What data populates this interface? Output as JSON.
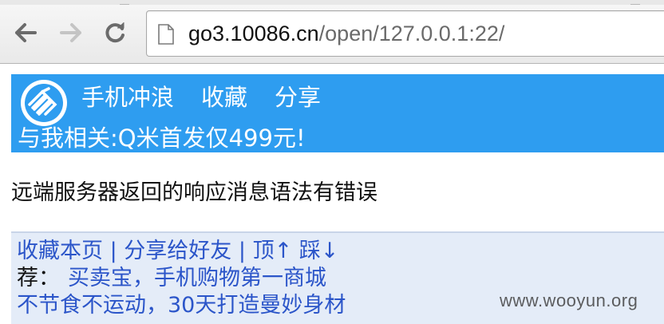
{
  "browser": {
    "url_host": "go3.10086.cn",
    "url_path": "/open/127.0.0.1:22/",
    "icons": {
      "back": "back-arrow-icon",
      "forward": "forward-arrow-icon",
      "reload": "reload-icon",
      "page": "document-page-icon"
    }
  },
  "header": {
    "logo": "china-mobile-logo",
    "nav": [
      "手机冲浪",
      "收藏",
      "分享"
    ],
    "promo": "与我相关:Q米首发仅499元!",
    "bg_color": "#2e9df0"
  },
  "main": {
    "error_message": "远端服务器返回的响应消息语法有错误"
  },
  "footer": {
    "links": {
      "bookmark": "收藏本页",
      "share": "分享给好友",
      "up": "顶↑",
      "down": "踩↓",
      "separator": "|"
    },
    "rec_label": "荐：",
    "rec_link1": "买卖宝，手机购物第一商城",
    "rec_link2": "不节食不运动，30天打造曼妙身材",
    "link_color": "#2b55c9",
    "bg_color": "#e4ecf8"
  },
  "watermark": "www.wooyun.org"
}
